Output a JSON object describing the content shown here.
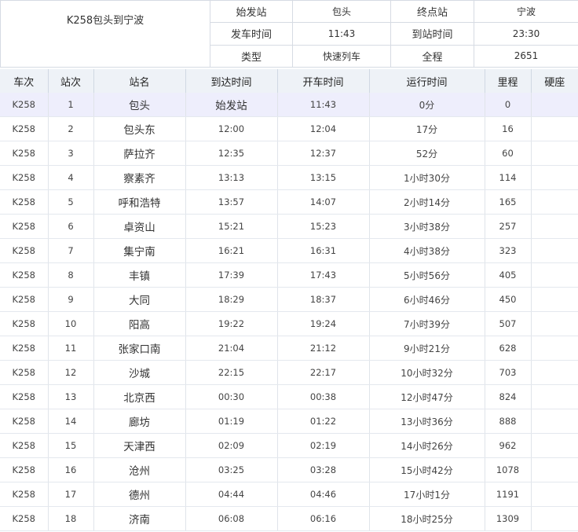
{
  "header": {
    "title": "K258包头到宁波",
    "labels": {
      "start_station": "始发站",
      "end_station": "终点站",
      "depart_time": "发车时间",
      "arrive_time": "到站时间",
      "type": "类型",
      "distance": "全程"
    },
    "values": {
      "start_station": "包头",
      "end_station": "宁波",
      "depart_time": "11:43",
      "arrive_time": "23:30",
      "type": "快速列车",
      "distance": "2651"
    }
  },
  "columns": [
    "车次",
    "站次",
    "站名",
    "到达时间",
    "开车时间",
    "运行时间",
    "里程",
    "硬座"
  ],
  "rows": [
    {
      "train": "K258",
      "no": "1",
      "station": "包头",
      "arrive": "始发站",
      "depart": "11:43",
      "runtime": "0分",
      "mileage": "0",
      "seat": ""
    },
    {
      "train": "K258",
      "no": "2",
      "station": "包头东",
      "arrive": "12:00",
      "depart": "12:04",
      "runtime": "17分",
      "mileage": "16",
      "seat": ""
    },
    {
      "train": "K258",
      "no": "3",
      "station": "萨拉齐",
      "arrive": "12:35",
      "depart": "12:37",
      "runtime": "52分",
      "mileage": "60",
      "seat": ""
    },
    {
      "train": "K258",
      "no": "4",
      "station": "察素齐",
      "arrive": "13:13",
      "depart": "13:15",
      "runtime": "1小时30分",
      "mileage": "114",
      "seat": ""
    },
    {
      "train": "K258",
      "no": "5",
      "station": "呼和浩特",
      "arrive": "13:57",
      "depart": "14:07",
      "runtime": "2小时14分",
      "mileage": "165",
      "seat": ""
    },
    {
      "train": "K258",
      "no": "6",
      "station": "卓资山",
      "arrive": "15:21",
      "depart": "15:23",
      "runtime": "3小时38分",
      "mileage": "257",
      "seat": ""
    },
    {
      "train": "K258",
      "no": "7",
      "station": "集宁南",
      "arrive": "16:21",
      "depart": "16:31",
      "runtime": "4小时38分",
      "mileage": "323",
      "seat": ""
    },
    {
      "train": "K258",
      "no": "8",
      "station": "丰镇",
      "arrive": "17:39",
      "depart": "17:43",
      "runtime": "5小时56分",
      "mileage": "405",
      "seat": ""
    },
    {
      "train": "K258",
      "no": "9",
      "station": "大同",
      "arrive": "18:29",
      "depart": "18:37",
      "runtime": "6小时46分",
      "mileage": "450",
      "seat": ""
    },
    {
      "train": "K258",
      "no": "10",
      "station": "阳高",
      "arrive": "19:22",
      "depart": "19:24",
      "runtime": "7小时39分",
      "mileage": "507",
      "seat": ""
    },
    {
      "train": "K258",
      "no": "11",
      "station": "张家口南",
      "arrive": "21:04",
      "depart": "21:12",
      "runtime": "9小时21分",
      "mileage": "628",
      "seat": ""
    },
    {
      "train": "K258",
      "no": "12",
      "station": "沙城",
      "arrive": "22:15",
      "depart": "22:17",
      "runtime": "10小时32分",
      "mileage": "703",
      "seat": ""
    },
    {
      "train": "K258",
      "no": "13",
      "station": "北京西",
      "arrive": "00:30",
      "depart": "00:38",
      "runtime": "12小时47分",
      "mileage": "824",
      "seat": ""
    },
    {
      "train": "K258",
      "no": "14",
      "station": "廊坊",
      "arrive": "01:19",
      "depart": "01:22",
      "runtime": "13小时36分",
      "mileage": "888",
      "seat": ""
    },
    {
      "train": "K258",
      "no": "15",
      "station": "天津西",
      "arrive": "02:09",
      "depart": "02:19",
      "runtime": "14小时26分",
      "mileage": "962",
      "seat": ""
    },
    {
      "train": "K258",
      "no": "16",
      "station": "沧州",
      "arrive": "03:25",
      "depart": "03:28",
      "runtime": "15小时42分",
      "mileage": "1078",
      "seat": ""
    },
    {
      "train": "K258",
      "no": "17",
      "station": "德州",
      "arrive": "04:44",
      "depart": "04:46",
      "runtime": "17小时1分",
      "mileage": "1191",
      "seat": ""
    },
    {
      "train": "K258",
      "no": "18",
      "station": "济南",
      "arrive": "06:08",
      "depart": "06:16",
      "runtime": "18小时25分",
      "mileage": "1309",
      "seat": ""
    }
  ],
  "colors": {
    "grid_border": "#d6dbe3",
    "header_bg": "#eef2f7",
    "highlight_row_bg": "#eeeefc",
    "text": "#333333"
  }
}
